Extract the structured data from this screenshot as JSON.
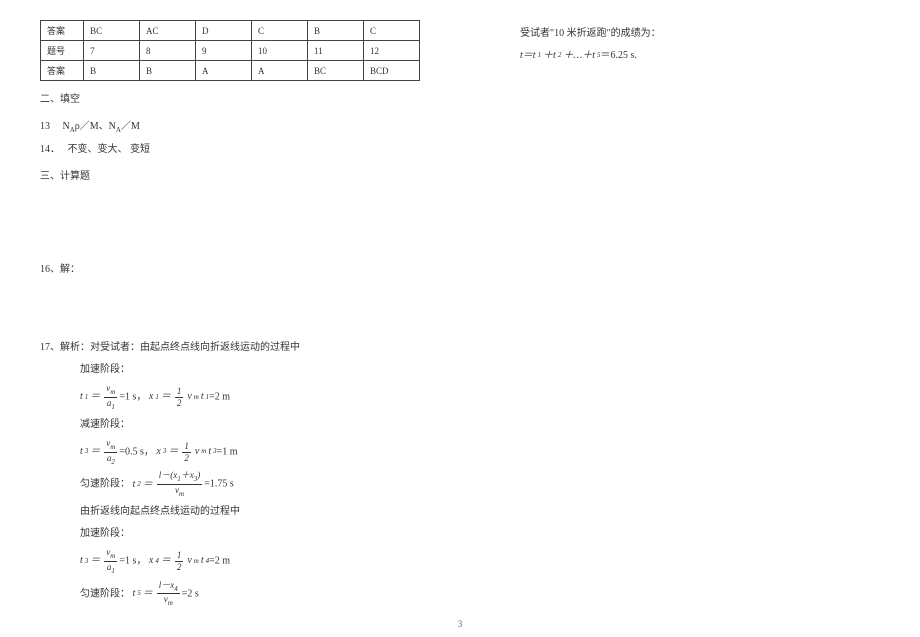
{
  "table": {
    "row1_label": "答案",
    "row1_cells": [
      "BC",
      "AC",
      "D",
      "C",
      "B",
      "C"
    ],
    "row2_label": "题号",
    "row2_cells": [
      "7",
      "8",
      "9",
      "10",
      "11",
      "12"
    ],
    "row3_label": "答案",
    "row3_cells": [
      "B",
      "B",
      "A",
      "A",
      "BC",
      "BCD"
    ]
  },
  "section2_title": "二、填空",
  "q13_label": "13",
  "q13_answer": "NAρ／M、NA／M",
  "q14_label": "14．",
  "q14_answer": "不变、变大、 变短",
  "section3_title": "三、计算题",
  "q16_label": "16、解：",
  "q17_label": "17、解析：对受试者：由起点终点线向折返线运动的过程中",
  "q17_accel_label": "加速阶段：",
  "q17_t1_eq": "=1 s，",
  "q17_x1_eq": "=2 m",
  "q17_decel_label": "减速阶段：",
  "q17_t3_eq": "=0.5 s，",
  "q17_x3_eq": "=1 m",
  "q17_uniform_label": "匀速阶段：",
  "q17_t2_eq": "=1.75 s",
  "q17_return_label": "由折返线向起点终点线运动的过程中",
  "q17_accel2_label": "加速阶段：",
  "q17_t3b_eq": "=1 s，",
  "q17_x4_eq": "=2 m",
  "q17_uniform2_label": "匀速阶段：",
  "q17_t5_eq": "=2 s",
  "right_line1": "受试者\"10 米折返跑\"的成绩为：",
  "right_line2_prefix": "t＝t",
  "right_line2_mid": "＋t",
  "right_line2_cont": "＋…＋t",
  "right_line2_end": "＝6.25 s.",
  "page_number": "3",
  "frac_vars": {
    "v_m": "v",
    "a1": "a",
    "a2": "a",
    "one": "1",
    "two": "2",
    "l": "l",
    "x1": "x",
    "x2": "x",
    "x4": "x"
  }
}
